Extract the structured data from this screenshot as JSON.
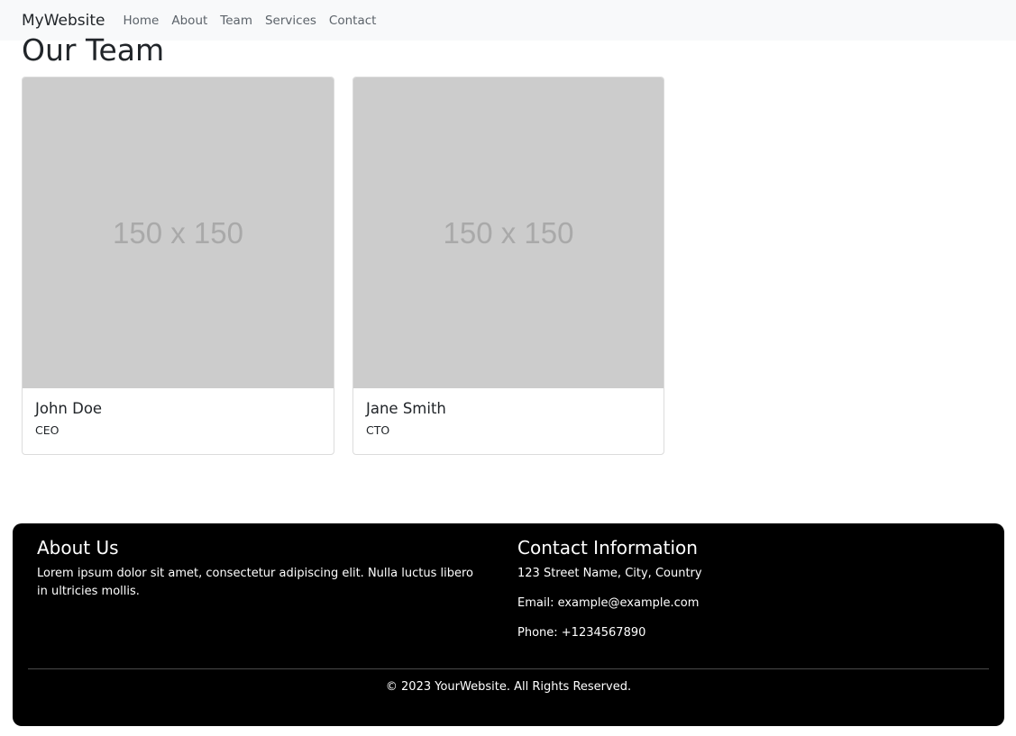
{
  "navbar": {
    "brand": "MyWebsite",
    "links": [
      "Home",
      "About",
      "Team",
      "Services",
      "Contact"
    ]
  },
  "main": {
    "title": "Our Team",
    "cards": [
      {
        "image_text": "150 x 150",
        "name": "John Doe",
        "role": "CEO"
      },
      {
        "image_text": "150 x 150",
        "name": "Jane Smith",
        "role": "CTO"
      }
    ]
  },
  "footer": {
    "about": {
      "heading": "About Us",
      "text": "Lorem ipsum dolor sit amet, consectetur adipiscing elit. Nulla luctus libero in ultricies mollis."
    },
    "contact": {
      "heading": "Contact Information",
      "address": "123 Street Name, City, Country",
      "email": "Email: example@example.com",
      "phone": "Phone: +1234567890"
    },
    "copyright": "© 2023 YourWebsite. All Rights Reserved."
  },
  "colors": {
    "navbar_bg": "#f8f9fa",
    "footer_bg": "#000000",
    "placeholder_bg": "#cccccc",
    "placeholder_text": "#a9a9a9"
  }
}
